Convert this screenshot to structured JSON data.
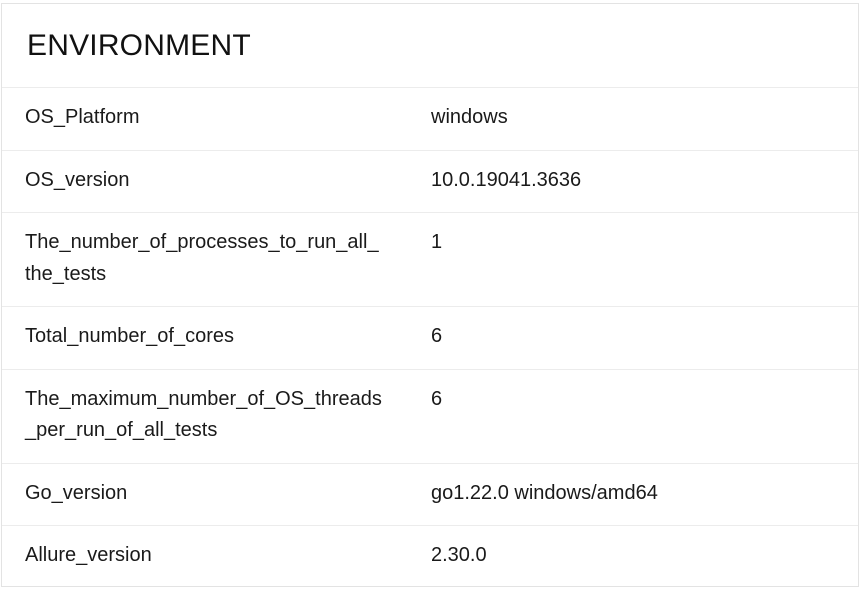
{
  "widget": {
    "title": "ENVIRONMENT"
  },
  "environment": {
    "rows": [
      {
        "key": "OS_Platform",
        "value": "windows"
      },
      {
        "key": "OS_version",
        "value": "10.0.19041.3636"
      },
      {
        "key": "The_number_of_processes_to_run_all_the_tests",
        "value": "1"
      },
      {
        "key": "Total_number_of_cores",
        "value": "6"
      },
      {
        "key": "The_maximum_number_of_OS_threads_per_run_of_all_tests",
        "value": "6"
      },
      {
        "key": "Go_version",
        "value": "go1.22.0 windows/amd64"
      },
      {
        "key": "Allure_version",
        "value": "2.30.0"
      }
    ]
  }
}
